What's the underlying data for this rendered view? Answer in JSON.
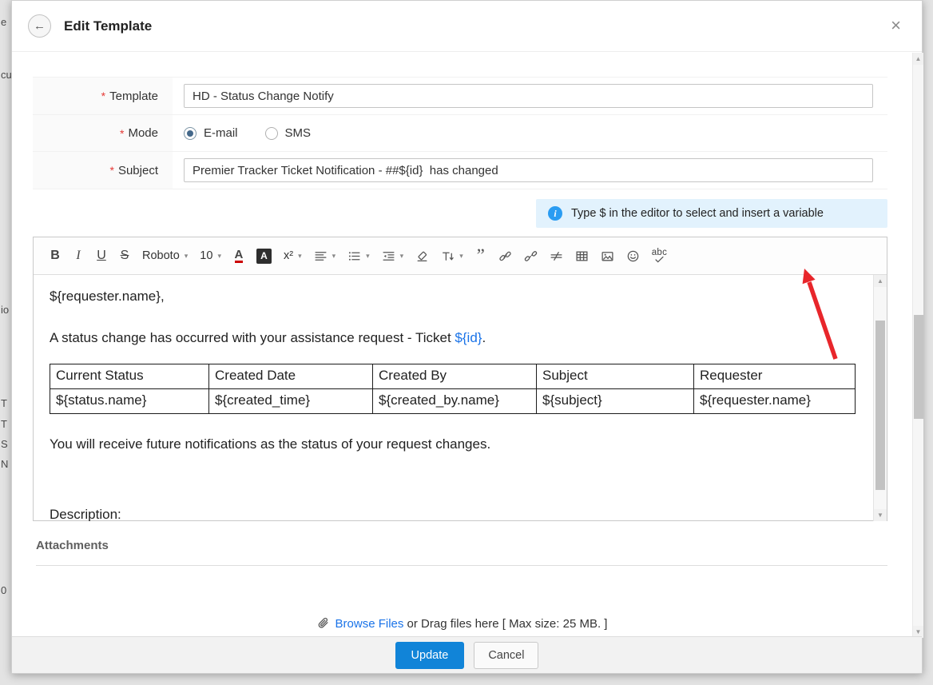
{
  "background": {
    "fragments": [
      "e",
      "cu",
      "io",
      "T",
      "T",
      "S",
      "N",
      "0"
    ]
  },
  "icons": {
    "back": "←",
    "close": "×",
    "chevron": "▾",
    "info": "i",
    "scroll_up": "▲",
    "scroll_down": "▼"
  },
  "modal": {
    "title": "Edit Template"
  },
  "form": {
    "required_marker": "*",
    "template_label": "Template",
    "template_value": "HD - Status Change Notify",
    "mode_label": "Mode",
    "mode_options": [
      {
        "label": "E-mail",
        "selected": true
      },
      {
        "label": "SMS",
        "selected": false
      }
    ],
    "subject_label": "Subject",
    "subject_value": "Premier Tracker Ticket Notification - ##${id}  has changed"
  },
  "hint": {
    "text": "Type $ in the editor to select and insert a variable"
  },
  "toolbar": {
    "bold": "B",
    "italic": "I",
    "underline": "U",
    "strikethrough": "S",
    "font_family": "Roboto",
    "font_size": "10",
    "font_color": "A",
    "highlight": "A",
    "superscript": "x²",
    "quote": "”",
    "spellcheck": "abc"
  },
  "editor": {
    "greeting": "${requester.name},",
    "body_before": "A status change has occurred with your assistance request - Ticket ",
    "body_var": "${id}",
    "body_after": ".",
    "table_headers": [
      "Current Status",
      "Created Date",
      "Created By",
      "Subject",
      "Requester"
    ],
    "table_row": [
      "${status.name}",
      "${created_time}",
      "${created_by.name}",
      "${subject}",
      "${requester.name}"
    ],
    "footer_line": "You will receive future notifications as the status of your request changes.",
    "description_label": "Description:"
  },
  "attachments": {
    "label": "Attachments",
    "browse_link": "Browse Files",
    "drag_text": "or Drag files here [ Max size: 25 MB. ]"
  },
  "actions": {
    "update": "Update",
    "cancel": "Cancel"
  },
  "colors": {
    "accent_blue": "#1184d8",
    "link_blue": "#1a73e8",
    "hint_bg": "#e2f2fd",
    "required_red": "#e53935",
    "arrow_red": "#e8262b"
  }
}
